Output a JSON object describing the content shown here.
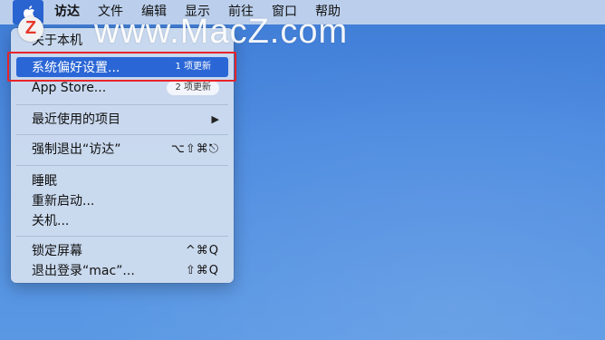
{
  "menubar": {
    "apple_icon": "apple-icon",
    "items": [
      "访达",
      "文件",
      "编辑",
      "显示",
      "前往",
      "窗口",
      "帮助"
    ]
  },
  "watermark": {
    "logo_letter": "Z",
    "text": "www.MacZ.com"
  },
  "apple_menu": {
    "about": "关于本机",
    "system_prefs": {
      "label": "系统偏好设置...",
      "badge": "1 项更新"
    },
    "app_store": {
      "label": "App Store...",
      "badge": "2 项更新"
    },
    "recent_items": {
      "label": "最近使用的项目",
      "arrow": "▶"
    },
    "force_quit": {
      "label": "强制退出“访达”",
      "shortcut": "⌥⇧⌘⎋"
    },
    "sleep": "睡眠",
    "restart": "重新启动...",
    "shutdown": "关机...",
    "lock_screen": {
      "label": "锁定屏幕",
      "shortcut": "^⌘Q"
    },
    "logout": {
      "label": "退出登录“mac”...",
      "shortcut": "⇧⌘Q"
    }
  },
  "colors": {
    "highlight": "#2a66d6",
    "annotation_box": "#e8242a",
    "desktop": "#4d8be0"
  }
}
